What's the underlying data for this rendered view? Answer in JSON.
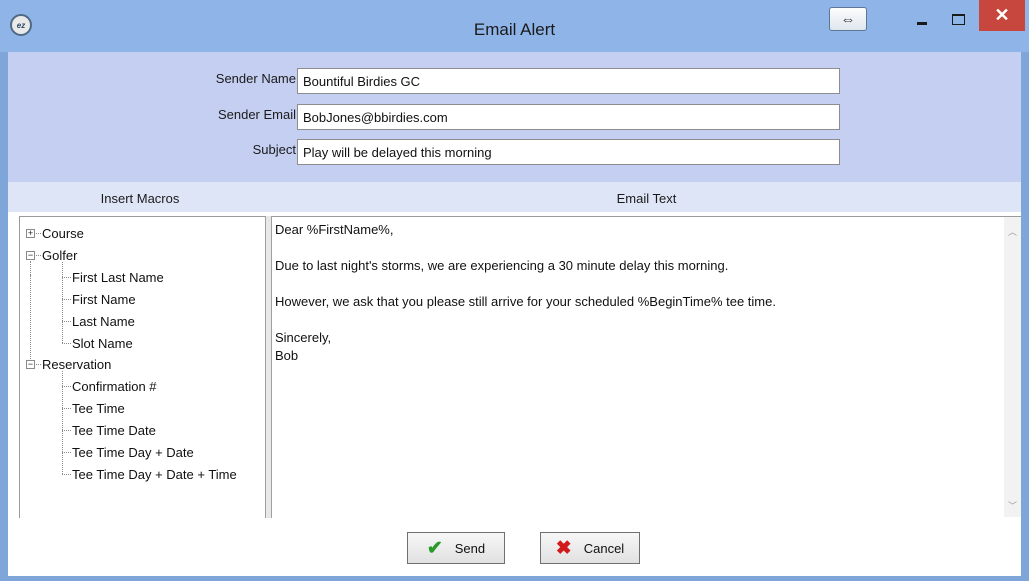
{
  "window": {
    "title": "Email Alert",
    "icon": "ez-app-icon",
    "icon_text": "ez",
    "resize_glyph": "⇔",
    "close_glyph": "✕"
  },
  "form": {
    "sender_name_label": "Sender Name",
    "sender_name_value": "Bountiful Birdies GC",
    "sender_email_label": "Sender Email",
    "sender_email_value": "BobJones@bbirdies.com",
    "subject_label": "Subject",
    "subject_value": "Play will be delayed this morning"
  },
  "headers": {
    "insert_macros": "Insert Macros",
    "email_text": "Email Text"
  },
  "tree": {
    "course": "Course",
    "golfer": "Golfer",
    "golfer_children": [
      "First Last Name",
      "First Name",
      "Last Name",
      "Slot Name"
    ],
    "reservation": "Reservation",
    "reservation_children": [
      "Confirmation #",
      "Tee Time",
      "Tee Time Date",
      "Tee Time Day + Date",
      "Tee Time Day + Date + Time"
    ],
    "expand_glyph": "+",
    "collapse_glyph": "−"
  },
  "email": {
    "body": "Dear %FirstName%,\n\nDue to last night's storms, we are experiencing a 30 minute delay this morning.\n\nHowever, we ask that you please still arrive for your scheduled %BeginTime% tee time.\n\nSincerely,\nBob"
  },
  "buttons": {
    "send_label": "Send",
    "send_icon": "✔",
    "cancel_label": "Cancel",
    "cancel_icon": "✖"
  },
  "colors": {
    "titlebar": "#8fb5e8",
    "form_bg": "#c5cff2",
    "close": "#c7473e",
    "send_check": "#2a9a2a",
    "cancel_x": "#d11a1a"
  }
}
